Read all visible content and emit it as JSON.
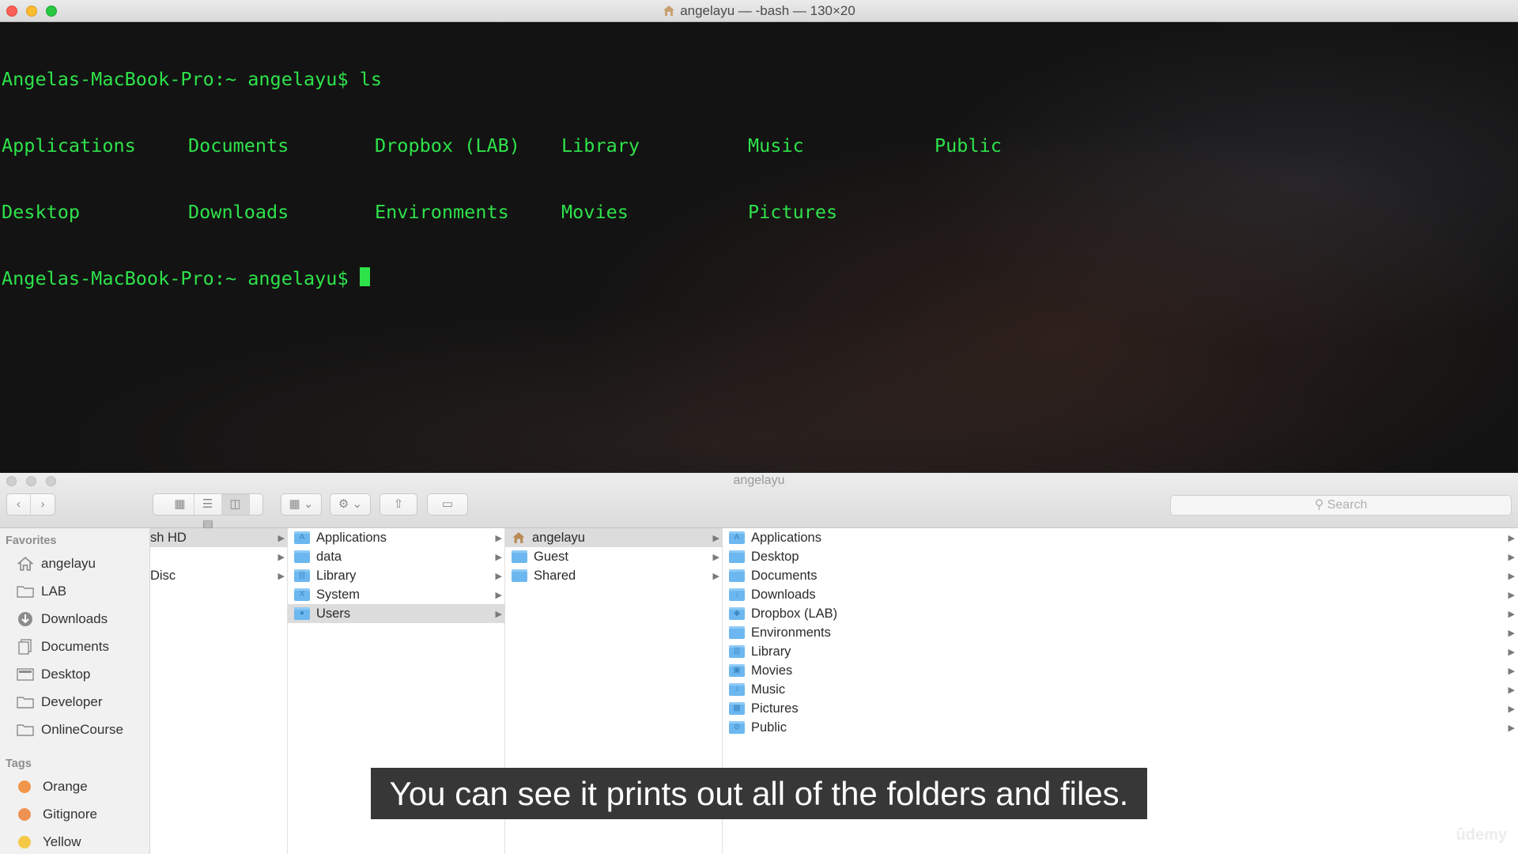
{
  "terminal": {
    "title": "angelayu — -bash — 130×20",
    "prompt_line_1": "Angelas-MacBook-Pro:~ angelayu$ ls",
    "ls_row_1": [
      "Applications",
      "Documents",
      "Dropbox (LAB)",
      "Library",
      "Music",
      "Public"
    ],
    "ls_row_2": [
      "Desktop",
      "Downloads",
      "Environments",
      "Movies",
      "Pictures"
    ],
    "prompt_line_2": "Angelas-MacBook-Pro:~ angelayu$ "
  },
  "finder": {
    "title": "angelayu",
    "search_placeholder": "Search",
    "sidebar": {
      "favorites_header": "Favorites",
      "favorites": [
        {
          "label": "angelayu",
          "icon": "home-icon"
        },
        {
          "label": "LAB",
          "icon": "folder-icon"
        },
        {
          "label": "Downloads",
          "icon": "download-icon"
        },
        {
          "label": "Documents",
          "icon": "documents-icon"
        },
        {
          "label": "Desktop",
          "icon": "desktop-icon"
        },
        {
          "label": "Developer",
          "icon": "folder-icon"
        },
        {
          "label": "OnlineCourse",
          "icon": "folder-icon"
        }
      ],
      "tags_header": "Tags",
      "tags": [
        {
          "label": "Orange",
          "color": "#f0954a"
        },
        {
          "label": "Gitignore",
          "color": "#ee9253"
        },
        {
          "label": "Yellow",
          "color": "#f5c945"
        }
      ]
    },
    "column_0": [
      "sh HD",
      "",
      "Disc"
    ],
    "column_1": [
      "Applications",
      "data",
      "Library",
      "System",
      "Users"
    ],
    "column_2": [
      "angelayu",
      "Guest",
      "Shared"
    ],
    "column_3": [
      "Applications",
      "Desktop",
      "Documents",
      "Downloads",
      "Dropbox (LAB)",
      "Environments",
      "Library",
      "Movies",
      "Music",
      "Pictures",
      "Public"
    ]
  },
  "caption": "You can see it prints out all of the folders and files.",
  "watermark": "ûdemy",
  "colors": {
    "terminal_text": "#2ee24a",
    "folder_blue": "#6cb7ef"
  }
}
